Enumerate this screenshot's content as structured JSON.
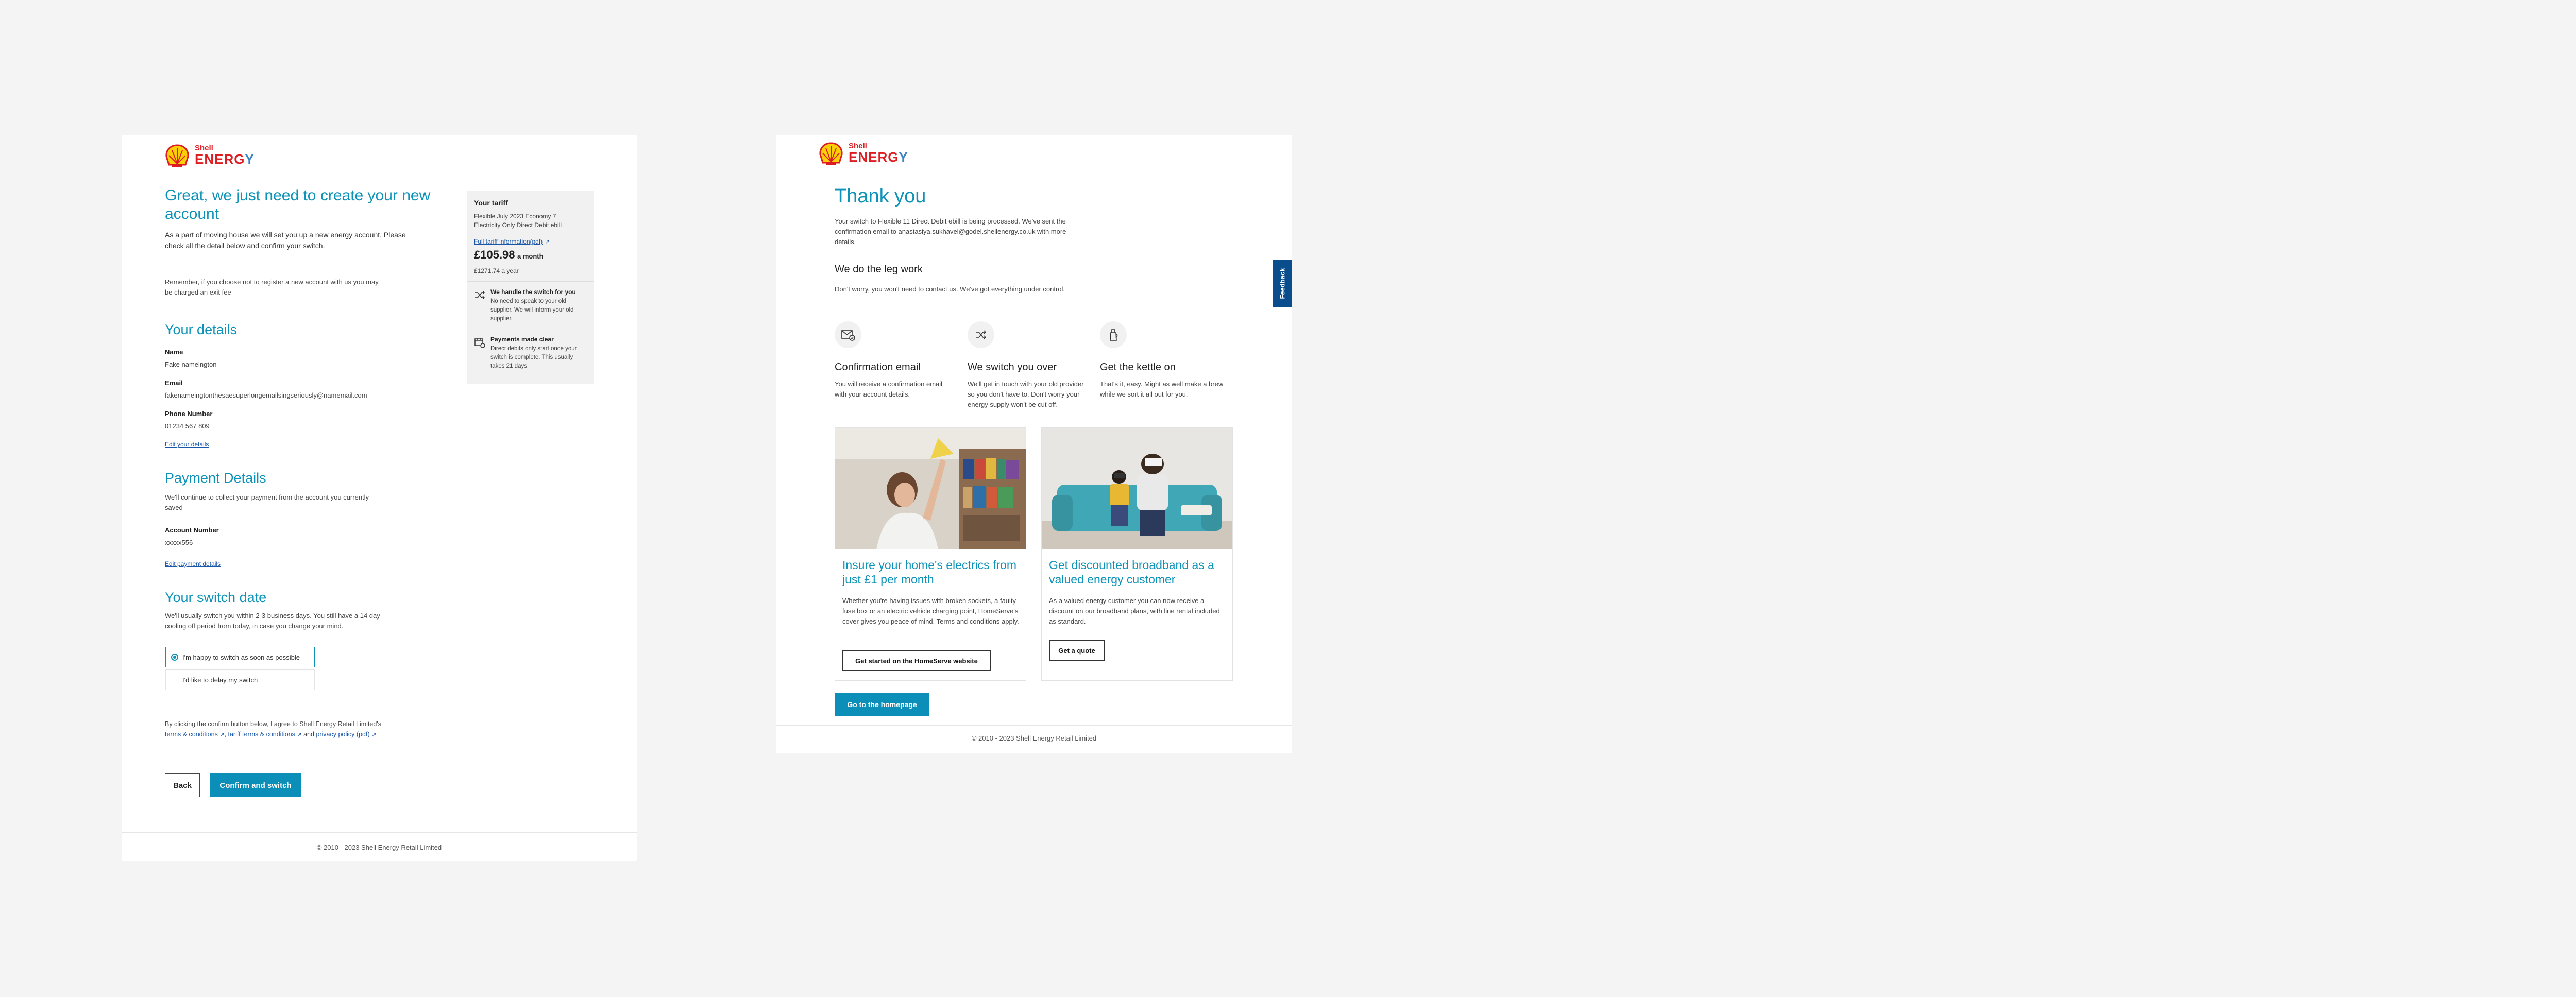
{
  "brand": {
    "line1": "Shell",
    "line2_a": "ENERG",
    "line2_b": "Y"
  },
  "left": {
    "title": "Great, we just need to create your new account",
    "intro": "As a part of moving house we will set you up a new energy account. Please check all the detail below and confirm your switch.",
    "reminder": "Remember, if you choose not to register a new account with us you may be charged an exit fee",
    "tariff": {
      "heading": "Your tariff",
      "name": "Flexible July 2023 Economy 7 Electricity Only Direct Debit ebill",
      "link": "Full tariff information(pdf)",
      "price": "£105.98",
      "per": "a month",
      "year": "£1271.74 a year",
      "b1_title": "We handle the switch for you",
      "b1_text": "No need to speak to your old supplier. We will inform your old supplier.",
      "b2_title": "Payments made clear",
      "b2_text": "Direct debits only start once your switch is complete. This usually takes 21 days"
    },
    "details": {
      "heading": "Your details",
      "name_label": "Name",
      "name_value": "Fake name­ington",
      "email_label": "Email",
      "email_value": "fakenameingtonthesaesuperlongemailsingseriously@namemail.com",
      "phone_label": "Phone Number",
      "phone_value": "01234 567 809",
      "edit": "Edit your details"
    },
    "payment": {
      "heading": "Payment Details",
      "text": "We'll continue to collect your payment from the account you currently saved",
      "acc_label": "Account Number",
      "acc_value": "xxxxx556",
      "edit": "Edit payment details"
    },
    "switch": {
      "heading": "Your switch date",
      "text": "We'll usually switch you within 2-3 business days. You still have a 14 day cooling off period from today, in case you change your mind.",
      "opt1": "I'm happy to switch as soon as possible",
      "opt2": "I'd like to delay my switch"
    },
    "terms": {
      "pre": "By clicking the confirm button below, I agree to Shell Energy Retail Limited's",
      "t1": "terms & conditions",
      "t2": "tariff terms & conditions",
      "and": "and",
      "t3": "privacy policy (pdf)"
    },
    "back": "Back",
    "confirm": "Confirm and switch",
    "footer": "© 2010 - 2023 Shell Energy Retail Limited"
  },
  "right": {
    "title": "Thank you",
    "text": "Your switch to Flexible 11 Direct Debit ebill is being processed. We've sent the confirmation email to anastasiya.sukhavel@godel.shellenergy.co.uk with more details.",
    "leg_heading": "We do the leg work",
    "leg_text": "Don't worry, you won't need to contact us. We've got everything under control.",
    "f1_title": "Confirmation email",
    "f1_text": "You will receive a confirmation email with your account details.",
    "f2_title": "We switch you over",
    "f2_text": "We'll get in touch with your old provider so you don't have to. Don't worry your energy supply won't be cut off.",
    "f3_title": "Get the kettle on",
    "f3_text": "That's it, easy. Might as well make a brew while we sort it all out for you.",
    "c1_title": "Insure your home's electrics from just £1 per month",
    "c1_text": "Whether you're having issues with broken sockets, a faulty fuse box or an electric vehicle charging point, HomeServe's cover gives you peace of mind. Terms and conditions apply.",
    "c1_btn": "Get started on the HomeServe website",
    "c2_title": "Get discounted broadband as a valued energy customer",
    "c2_text": "As a valued energy customer you can now receive a discount on our broadband plans, with line rental included as standard.",
    "c2_btn": "Get a quote",
    "home_btn": "Go to the homepage",
    "footer": "© 2010 - 2023 Shell Energy Retail Limited",
    "feedback": "Feedback"
  },
  "colors": {
    "accent": "#0e93b8",
    "shell_red": "#dd1d21",
    "shell_yellow": "#fbce07",
    "feedback": "#0a4d8c"
  }
}
